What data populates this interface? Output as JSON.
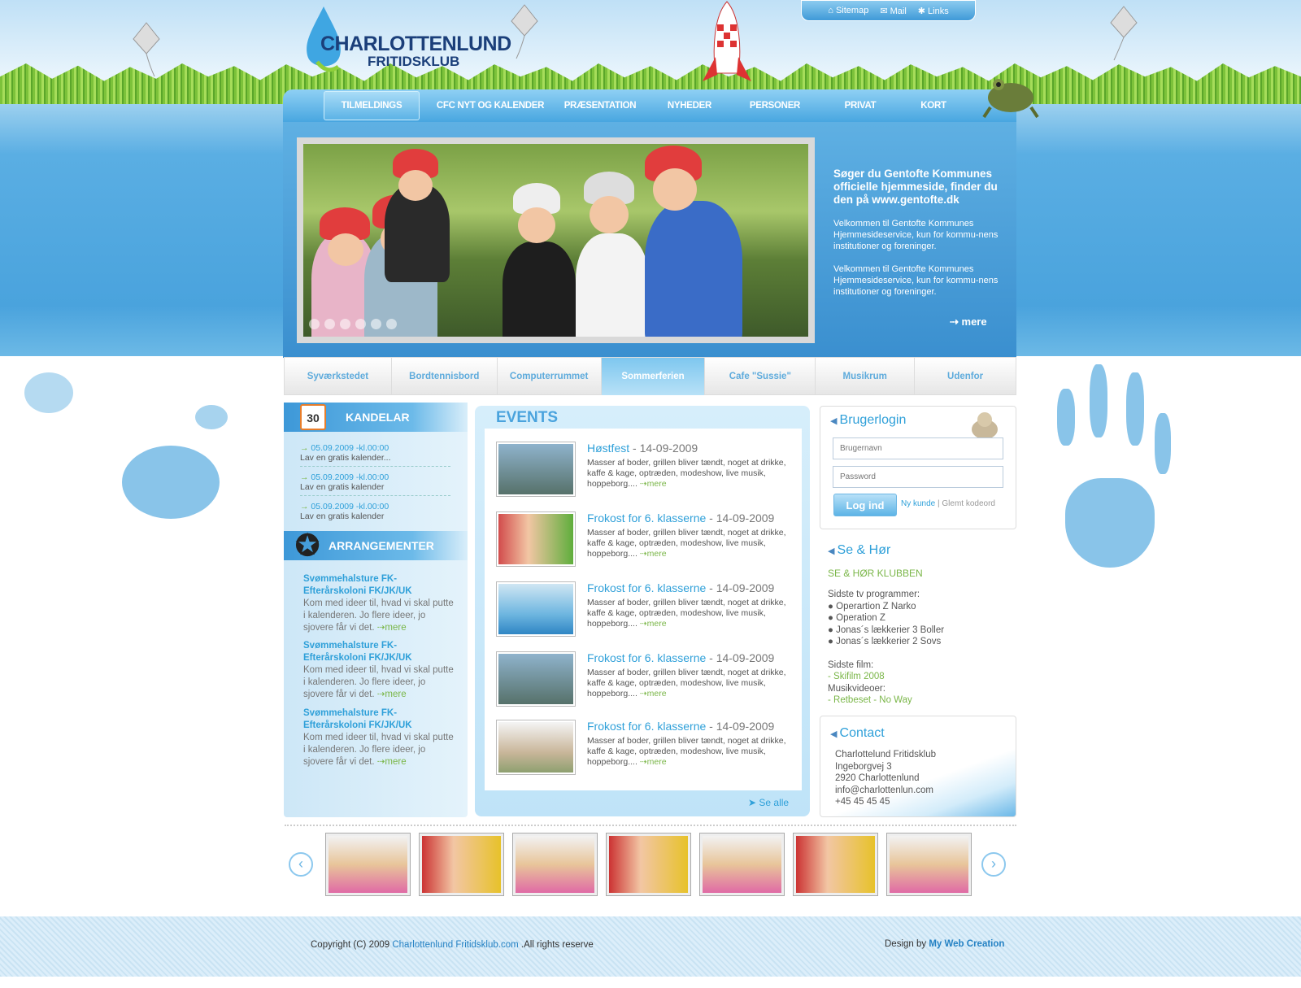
{
  "logo": {
    "line1": "CHARLOTTENLUND",
    "line2": "FRITIDSKLUB"
  },
  "toplinks": [
    "Sitemap",
    "Mail",
    "Links"
  ],
  "nav": [
    "TILMELDINGS SEDLER",
    "CFC NYT OG KALENDER",
    "PRÆSENTATION",
    "NYHEDER",
    "PERSONER",
    "PRIVAT",
    "KORT"
  ],
  "hero": {
    "heading": "Søger du Gentofte Kommunes officielle hjemmeside, finder du den på www.gentofte.dk",
    "p1": "Velkommen til Gentofte Kommunes Hjemmesideservice, kun for kommu-nens institutioner og foreninger.",
    "p2": "Velkommen til Gentofte Kommunes Hjemmesideservice, kun for kommu-nens institutioner og foreninger.",
    "more": "mere"
  },
  "tabs": [
    "Syværkstedet",
    "Bordtennisbord",
    "Computerrummet",
    "Sommerferien",
    "Cafe \"Sussie\"",
    "Musikrum",
    "Udenfor"
  ],
  "kalendar": {
    "title": "KANDELAR",
    "cal_num": "30",
    "items": [
      {
        "date": "05.09.2009 -kl.00:00",
        "text": "Lav en gratis kalender..."
      },
      {
        "date": "05.09.2009 -kl.00:00",
        "text": "Lav en gratis kalender"
      },
      {
        "date": "05.09.2009 -kl.00:00",
        "text": "Lav en gratis kalender"
      }
    ]
  },
  "arrangementer": {
    "title": "ARRANGEMENTER",
    "items": [
      {
        "title": "Svømmehalsture FK-Efterårskoloni FK/JK/UK",
        "desc": "Kom med ideer til, hvad vi skal putte i kalenderen. Jo flere ideer, jo sjovere får vi det.",
        "more": "mere"
      },
      {
        "title": "Svømmehalsture FK-Efterårskoloni FK/JK/UK",
        "desc": "Kom med ideer til, hvad vi skal putte i kalenderen. Jo flere ideer, jo sjovere får vi det.",
        "more": "mere"
      },
      {
        "title": "Svømmehalsture FK-Efterårskoloni FK/JK/UK",
        "desc": "Kom med ideer til, hvad vi skal putte i kalenderen. Jo flere ideer, jo sjovere får vi det.",
        "more": "mere"
      }
    ]
  },
  "events": {
    "title": "EVENTS",
    "items": [
      {
        "title": "Høstfest",
        "date": " - 14-09-2009",
        "desc": "Masser af boder, grillen bliver tændt, noget at drikke, kaffe & kage, optræden, modeshow, live musik, hoppeborg....",
        "more": "mere"
      },
      {
        "title": "Frokost for 6. klasserne",
        "date": " - 14-09-2009",
        "desc": "Masser af boder, grillen bliver tændt, noget at drikke, kaffe & kage, optræden, modeshow, live musik, hoppeborg....",
        "more": "mere"
      },
      {
        "title": "Frokost for 6. klasserne",
        "date": " - 14-09-2009",
        "desc": "Masser af boder, grillen bliver tændt, noget at drikke, kaffe & kage, optræden, modeshow, live musik, hoppeborg....",
        "more": "mere"
      },
      {
        "title": "Frokost for 6. klasserne",
        "date": " - 14-09-2009",
        "desc": "Masser af boder, grillen bliver tændt, noget at drikke, kaffe & kage, optræden, modeshow, live musik, hoppeborg....",
        "more": "mere"
      },
      {
        "title": "Frokost for 6. klasserne",
        "date": " - 14-09-2009",
        "desc": "Masser af boder, grillen bliver tændt, noget at drikke, kaffe & kage, optræden, modeshow, live musik, hoppeborg....",
        "more": "mere"
      }
    ],
    "see_all": "Se alle"
  },
  "login": {
    "title": "Brugerlogin",
    "user_placeholder": "Brugernavn",
    "pass_placeholder": "Password",
    "button": "Log ind",
    "new_customer": "Ny kunde",
    "sep": " | ",
    "forgot": "Glemt kodeord"
  },
  "sehor": {
    "title": "Se & Hør",
    "club": "SE & HØR KLUBBEN",
    "tv_label": "Sidste tv programmer:",
    "tv": [
      "●  Operartion Z Narko",
      "●  Operation Z",
      "●  Jonas´s lækkerier 3 Boller",
      "●  Jonas´s lækkerier  2 Sovs"
    ],
    "film_label": "Sidste film:",
    "film": "- Skifilm 2008",
    "music_label": "Musikvideoer:",
    "music": "- Retbeset",
    "music_rest": " - No Way"
  },
  "contact": {
    "title": "Contact",
    "lines": [
      "Charlottelund Fritidsklub",
      "Ingeborgvej 3",
      "2920 Charlottenlund",
      "info@charlottenlun.com",
      "+45 45 45 45"
    ]
  },
  "footer": {
    "copy_pre": "Copyright (C) 2009 ",
    "copy_link": "Charlottenlund Fritidsklub.com",
    "copy_post": " .All rights reserve",
    "design_pre": "Design by ",
    "design_link": "My Web Creation"
  },
  "colors": {
    "accent": "#2fa0d9",
    "green": "#7ab648",
    "nav_blue": "#48a6e0"
  }
}
